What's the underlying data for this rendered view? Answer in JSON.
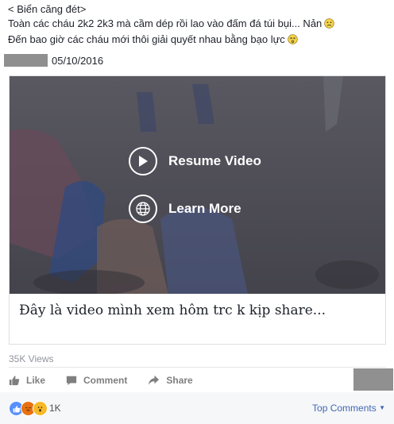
{
  "post": {
    "line1": "< Biển căng đét>",
    "line2": "Toàn các cháu 2k2 2k3 mà cầm dép rồi lao vào đấm đá túi bụi... Nản",
    "line3": "Đến bao giờ các cháu mới thôi giải quyết nhau bằng bạo lực",
    "date": "05/10/2016"
  },
  "video": {
    "resume_label": "Resume Video",
    "learn_label": "Learn More",
    "caption": "Đây là video mình xem hôm trc k kịp share..."
  },
  "stats": {
    "views": "35K Views"
  },
  "actions": {
    "like": "Like",
    "comment": "Comment",
    "share": "Share"
  },
  "reactions": {
    "count": "1K",
    "top_comments": "Top Comments"
  },
  "colors": {
    "accent": "#4267b2",
    "like_blue": "#5890ff",
    "angry": "#e9710f",
    "wow": "#f7b928"
  }
}
